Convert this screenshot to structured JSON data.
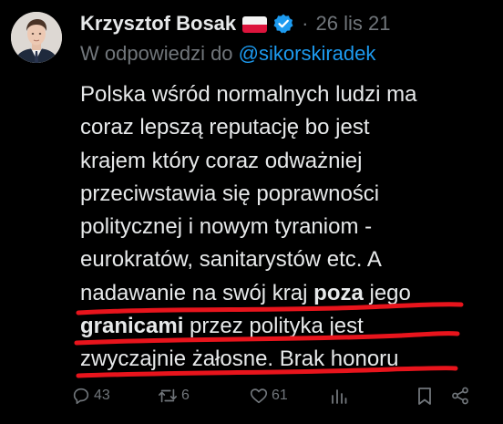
{
  "author": {
    "display_name": "Krzysztof Bosak",
    "separator": "·",
    "date": "26 lis 21"
  },
  "reply": {
    "prefix": "W odpowiedzi do",
    "handle": "@sikorskiradek"
  },
  "tweet": {
    "line1": "Polska wśród normalnych ludzi ma",
    "line2": "coraz lepszą reputację bo jest",
    "line3": "krajem który coraz odważniej",
    "line4": "przeciwstawia się poprawności",
    "line5": "politycznej i nowym tyraniom -",
    "line6": "eurokratów, sanitarystów etc. A",
    "line7_a": "nadawanie na swój kraj ",
    "line7_b": "poza",
    "line7_c": " jego",
    "line8_a": "granicami",
    "line8_b": " przez polityka jest",
    "line9": "zwyczajnie żałosne. Brak honoru"
  },
  "actions": {
    "replies": "43",
    "reposts": "6",
    "likes": "61"
  },
  "colors": {
    "background": "#000000",
    "text": "#e7e9ea",
    "secondary": "#71767b",
    "link": "#1d9bf0",
    "verified": "#1d9bf0",
    "underline": "#e8141c"
  },
  "icons": [
    "reply-icon",
    "repost-icon",
    "like-icon",
    "views-icon",
    "bookmark-icon",
    "share-icon",
    "verified-badge-icon",
    "poland-flag-icon"
  ]
}
